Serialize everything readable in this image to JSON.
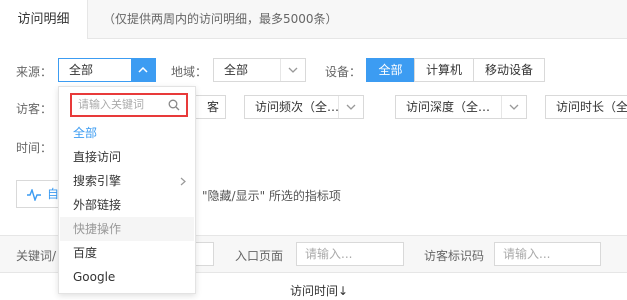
{
  "tabs": {
    "active": "访问明细",
    "note": "（仅提供两周内的访问明细，最多5000条）"
  },
  "filters": {
    "source_label": "来源：",
    "source_value": "全部",
    "region_label": "地域：",
    "region_value": "全部",
    "device_label": "设备：",
    "device_options": [
      "全部",
      "计算机",
      "移动设备"
    ],
    "visitor_label": "访客：",
    "visitor_partial": "客",
    "freq_value": "访问频次（全…",
    "depth_value": "访问深度（全…",
    "duration_value": "访问时长（全",
    "time_label": "时间："
  },
  "hint": {
    "partial_button": "自",
    "text": "\"隐藏/显示\" 所选的指标项"
  },
  "dropdown": {
    "search_placeholder": "请输入关键词",
    "options": [
      "全部",
      "直接访问",
      "搜索引擎",
      "外部链接",
      "快捷操作",
      "百度",
      "Google"
    ]
  },
  "bottom_filters": {
    "keyword_label": "关键词/",
    "entry_label": "入口页面",
    "entry_placeholder": "请输入...",
    "visitor_id_label": "访客标识码",
    "visitor_id_placeholder": "请输入..."
  },
  "table": {
    "time_header": "访问时间↓"
  },
  "colors": {
    "accent": "#3c9cf2",
    "highlight": "#e83a3a"
  }
}
